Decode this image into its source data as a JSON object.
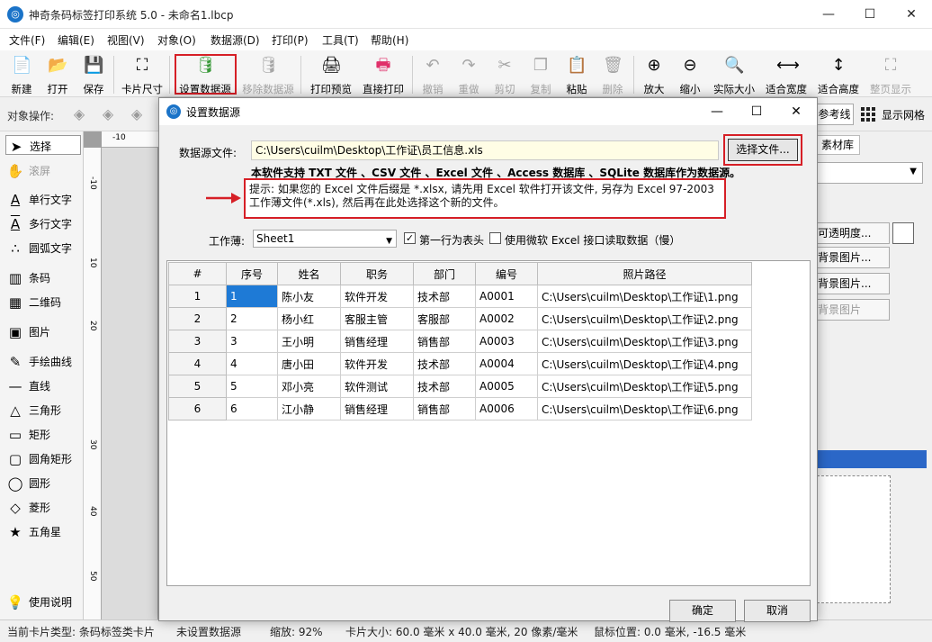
{
  "window": {
    "title": "神奇条码标签打印系统 5.0 - 未命名1.lbcp",
    "app_icon_glyph": "◎",
    "minimize": "—",
    "maximize": "☐",
    "close": "✕"
  },
  "menu": [
    "文件(F)",
    "编辑(E)",
    "视图(V)",
    "对象(O)",
    "数据源(D)",
    "打印(P)",
    "工具(T)",
    "帮助(H)"
  ],
  "toolbar": {
    "new": "新建",
    "open": "打开",
    "save": "保存",
    "card_size": "卡片尺寸",
    "set_datasource": "设置数据源",
    "remove_datasource": "移除数据源",
    "print_preview": "打印预览",
    "direct_print": "直接打印",
    "undo": "撤销",
    "redo": "重做",
    "cut": "剪切",
    "copy": "复制",
    "paste": "粘贴",
    "delete": "删除",
    "zoom_in": "放大",
    "zoom_out": "缩小",
    "actual_size": "实际大小",
    "fit_width": "适合宽度",
    "fit_height": "适合高度",
    "full_page": "整页显示"
  },
  "object_ops": {
    "label": "对象操作:",
    "guide": "参考线",
    "show_grid": "显示网格"
  },
  "tools": [
    {
      "icon": "➤",
      "label": "选择"
    },
    {
      "icon": "✋",
      "label": "滚屏"
    },
    {
      "icon": "A",
      "label": "单行文字"
    },
    {
      "icon": "A",
      "label": "多行文字"
    },
    {
      "icon": "∴",
      "label": "圆弧文字"
    },
    {
      "icon": "▥",
      "label": "条码"
    },
    {
      "icon": "▦",
      "label": "二维码"
    },
    {
      "icon": "▣",
      "label": "图片"
    },
    {
      "icon": "✎",
      "label": "手绘曲线"
    },
    {
      "icon": "—",
      "label": "直线"
    },
    {
      "icon": "△",
      "label": "三角形"
    },
    {
      "icon": "▭",
      "label": "矩形"
    },
    {
      "icon": "▢",
      "label": "圆角矩形"
    },
    {
      "icon": "◯",
      "label": "圆形"
    },
    {
      "icon": "◇",
      "label": "菱形"
    },
    {
      "icon": "★",
      "label": "五角星"
    },
    {
      "icon": "💡",
      "label": "使用说明"
    }
  ],
  "ruler": {
    "top_first": "-10",
    "left": [
      "-10",
      "10",
      "20",
      "30",
      "40",
      "50"
    ]
  },
  "right_panel": {
    "tab": "素材库",
    "buttons": [
      "可透明度...",
      "背景图片...",
      "背景图片...",
      "背景图片"
    ]
  },
  "status": {
    "card_type": "当前卡片类型: 条码标签类卡片",
    "datasource": "未设置数据源",
    "zoom": "缩放: 92%",
    "size": "卡片大小: 60.0 毫米 x 40.0 毫米, 20 像素/毫米",
    "position": "鼠标位置: 0.0 毫米, -16.5 毫米"
  },
  "dialog": {
    "title": "设置数据源",
    "datasource_label": "数据源文件:",
    "datasource_path": "C:\\Users\\cuilm\\Desktop\\工作证\\员工信息.xls",
    "choose_button": "选择文件...",
    "support_text": "本软件支持 TXT 文件 、CSV 文件 、Excel 文件 、Access 数据库 、SQLite 数据库作为数据源。",
    "hint_text": "提示: 如果您的 Excel 文件后缀是 *.xlsx, 请先用 Excel 软件打开该文件, 另存为 Excel 97-2003 工作薄文件(*.xls), 然后再在此处选择这个新的文件。",
    "workbook_label": "工作薄:",
    "workbook_value": "Sheet1",
    "first_row_header": "第一行为表头",
    "first_row_checked": "✓",
    "use_ms_excel": "使用微软 Excel 接口读取数据（慢）",
    "ok": "确定",
    "cancel": "取消",
    "table": {
      "headers": [
        "#",
        "序号",
        "姓名",
        "职务",
        "部门",
        "编号",
        "照片路径"
      ],
      "rows": [
        [
          "1",
          "1",
          "陈小友",
          "软件开发",
          "技术部",
          "A0001",
          "C:\\Users\\cuilm\\Desktop\\工作证\\1.png"
        ],
        [
          "2",
          "2",
          "杨小红",
          "客服主管",
          "客服部",
          "A0002",
          "C:\\Users\\cuilm\\Desktop\\工作证\\2.png"
        ],
        [
          "3",
          "3",
          "王小明",
          "销售经理",
          "销售部",
          "A0003",
          "C:\\Users\\cuilm\\Desktop\\工作证\\3.png"
        ],
        [
          "4",
          "4",
          "唐小田",
          "软件开发",
          "技术部",
          "A0004",
          "C:\\Users\\cuilm\\Desktop\\工作证\\4.png"
        ],
        [
          "5",
          "5",
          "邓小亮",
          "软件测试",
          "技术部",
          "A0005",
          "C:\\Users\\cuilm\\Desktop\\工作证\\5.png"
        ],
        [
          "6",
          "6",
          "江小静",
          "销售经理",
          "销售部",
          "A0006",
          "C:\\Users\\cuilm\\Desktop\\工作证\\6.png"
        ]
      ]
    }
  },
  "colors": {
    "highlight": "#d61f26",
    "selection": "#1e7ad6",
    "input_bg": "#fffde5"
  }
}
